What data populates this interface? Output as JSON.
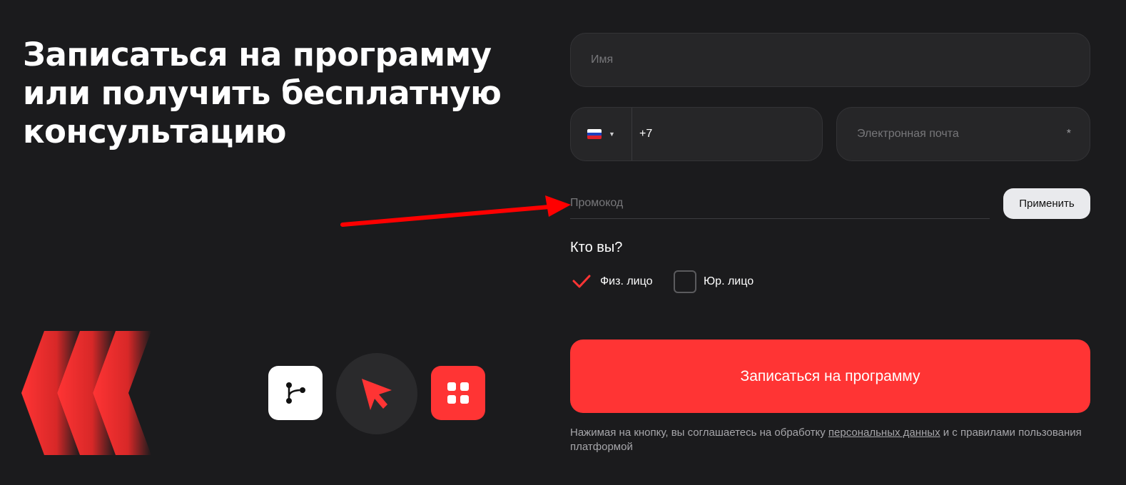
{
  "heading": "Записаться на программу или получить бесплатную консультацию",
  "form": {
    "name_placeholder": "Имя",
    "phone": {
      "country_flag": "flag-russia-icon",
      "prefix": "+7"
    },
    "email_placeholder": "Электронная почта",
    "email_required_mark": "*",
    "promo_placeholder": "Промокод",
    "apply_label": "Применить",
    "who_title": "Кто вы?",
    "options": [
      {
        "label": "Физ. лицо",
        "checked": true
      },
      {
        "label": "Юр. лицо",
        "checked": false
      }
    ],
    "submit_label": "Записаться на программу",
    "consent": {
      "before": "Нажимая на кнопку, вы соглашаетесь на обработку ",
      "link": "персональных данных",
      "after": " и с правилами пользования платформой"
    }
  },
  "features": [
    {
      "icon": "branch-icon"
    },
    {
      "icon": "cursor-icon"
    },
    {
      "icon": "grid-icon"
    }
  ],
  "colors": {
    "background": "#1b1b1d",
    "accent": "#ff3434",
    "field": "#262628",
    "annotation": "#ff0000"
  }
}
